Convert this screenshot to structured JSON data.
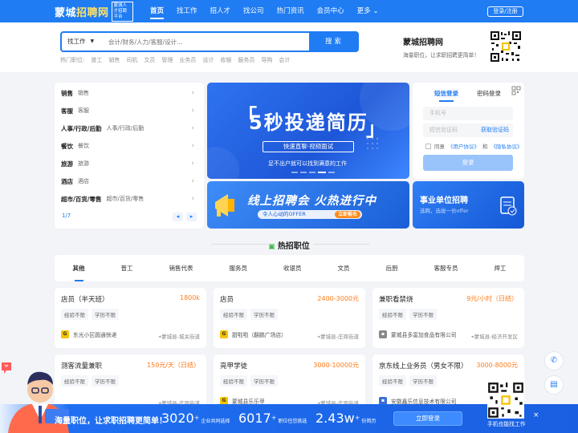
{
  "topbar": {
    "logo": {
      "part1": "蒙城",
      "part2": "招聘网",
      "badge": "蒙城人才招聘平台"
    },
    "nav": [
      "首页",
      "找工作",
      "招人才",
      "找公司",
      "热门资讯",
      "会员中心",
      "更多"
    ],
    "login_label": "登录/注册"
  },
  "search": {
    "type_label": "找工作",
    "placeholder": "会计/财务/人力/客服/设计...",
    "button_label": "搜 索",
    "hot_label": "热门职位:",
    "hot_words": [
      "普工",
      "销售",
      "司机",
      "文员",
      "管理",
      "业务员",
      "设计",
      "收银",
      "服务员",
      "导购",
      "会计"
    ]
  },
  "brand": {
    "title": "蒙城招聘网",
    "subtitle": "海量职位，让求职招聘更简单！"
  },
  "categories": [
    {
      "main": "销售",
      "sub": "销售"
    },
    {
      "main": "客服",
      "sub": "客服"
    },
    {
      "main": "人事/行政/后勤",
      "sub": "人事/行政/后勤"
    },
    {
      "main": "餐饮",
      "sub": "餐饮"
    },
    {
      "main": "旅游",
      "sub": "旅游"
    },
    {
      "main": "酒店",
      "sub": "酒店"
    },
    {
      "main": "超市/百货/零售",
      "sub": "超市/百货/零售"
    }
  ],
  "pager": {
    "text": "1/7"
  },
  "banner1": {
    "title": "5秒投递简历",
    "subtitle": "快速直聊·视频面试",
    "note": "足不出户就可以找到满意的工作",
    "slide_index": 4,
    "slide_count": 5
  },
  "banner2": {
    "title": "线上招聘会 火热进行中",
    "pill": "令人心动的OFFER",
    "pill_btn": "立即报名"
  },
  "login_box": {
    "tab_sms": "短信登录",
    "tab_pwd": "密码登录",
    "phone_placeholder": "手机号",
    "code_placeholder": "短信验证码",
    "get_code": "获取验证码",
    "agree_pre": "同意",
    "agree_user": "《用户协议》",
    "agree_and": "和",
    "agree_privacy": "《隐私协议》",
    "button": "登录"
  },
  "promo": {
    "title": "事业单位招聘",
    "subtitle": "选聘，选拔一份offer"
  },
  "hot_section": {
    "title": "热招职位"
  },
  "job_tabs": [
    "其他",
    "普工",
    "销售代表",
    "服务员",
    "收银员",
    "文员",
    "后厨",
    "客服专员",
    "焊工"
  ],
  "jobs": [
    {
      "title": "店员（半天班）",
      "salary": "1800k",
      "tags": [
        "经验不限",
        "学历不限"
      ],
      "company": "东光小区圆通快递",
      "location": "蒙城县-城关街道"
    },
    {
      "title": "店员",
      "salary": "2400-3000元",
      "tags": [
        "经验不限",
        "学历不限"
      ],
      "company": "甜啦啦（翻鹏广场店）",
      "location": "蒙城县-庄周街道"
    },
    {
      "title": "兼职看禁烧",
      "salary": "9元/小时（日结）",
      "tags": [
        "经验不限",
        "学历不限"
      ],
      "company": "蒙城县多富加食品有限公司",
      "location": "蒙城县-经济开发区"
    },
    {
      "title": "测客流量兼职",
      "salary": "150元/天（日结）",
      "tags": [
        "经验不限",
        "学历不限"
      ],
      "company": "",
      "location": "蒙城县-庄周街道"
    },
    {
      "title": "亮甲学徒",
      "salary": "3000-10000元",
      "tags": [
        "经验不限",
        "学历不限"
      ],
      "company": "蒙城县乐乐甲",
      "location": "蒙城县-庄周街道"
    },
    {
      "title": "京东线上业务员（男女不限）",
      "salary": "3000-8000元",
      "tags": [
        "经验不限",
        "学历不限"
      ],
      "company": "安徽鑫乐信息技术有限公司",
      "location": ""
    }
  ],
  "bottom_bar": {
    "text": "海量职位，让求职招聘更简单！",
    "stats": [
      {
        "num": "3020",
        "label": "企业共同选择"
      },
      {
        "num": "6017",
        "label": "职位任您挑选"
      },
      {
        "num": "2.43w",
        "label": "份简历"
      }
    ],
    "button": "立即登录",
    "app_text": "手机也能找工作",
    "close": "×"
  },
  "colors": {
    "brand": "#1f7cf3",
    "salary": "#ff7a1a",
    "logo_accent": "#ffe26a"
  }
}
